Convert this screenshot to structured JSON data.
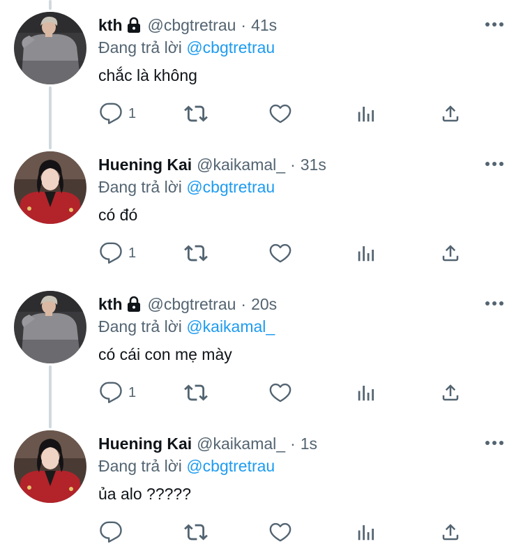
{
  "colors": {
    "text_primary": "#0f1419",
    "text_secondary": "#536471",
    "link": "#1d9bf0",
    "thread_line": "#cfd9de",
    "icon": "#536471"
  },
  "icons": {
    "reply": "speech-bubble",
    "retweet": "two-arrows-loop",
    "like": "heart",
    "views": "bar-chart",
    "share": "upload-arrow",
    "more": "three-dots",
    "lock": "padlock"
  },
  "tweets": [
    {
      "display_name": "kth",
      "locked": true,
      "handle": "@cbgtretrau",
      "separator": "·",
      "time": "41s",
      "reply_prefix": "Đang trả lời ",
      "reply_to": "@cbgtretrau",
      "text": "chắc là không",
      "reply_count": "1",
      "avatar": "kth"
    },
    {
      "display_name": "Huening Kai",
      "locked": false,
      "handle": "@kaikamal_",
      "separator": "·",
      "time": "31s",
      "reply_prefix": "Đang trả lời ",
      "reply_to": "@cbgtretrau",
      "text": "có đó",
      "reply_count": "1",
      "avatar": "kai"
    },
    {
      "display_name": "kth",
      "locked": true,
      "handle": "@cbgtretrau",
      "separator": "·",
      "time": "20s",
      "reply_prefix": "Đang trả lời ",
      "reply_to": "@kaikamal_",
      "text": "có cái con mẹ mày",
      "reply_count": "1",
      "avatar": "kth"
    },
    {
      "display_name": "Huening Kai",
      "locked": false,
      "handle": "@kaikamal_",
      "separator": "·",
      "time": "1s",
      "reply_prefix": "Đang trả lời ",
      "reply_to": "@cbgtretrau",
      "text": "ủa alo ?????",
      "reply_count": "",
      "avatar": "kai"
    }
  ]
}
